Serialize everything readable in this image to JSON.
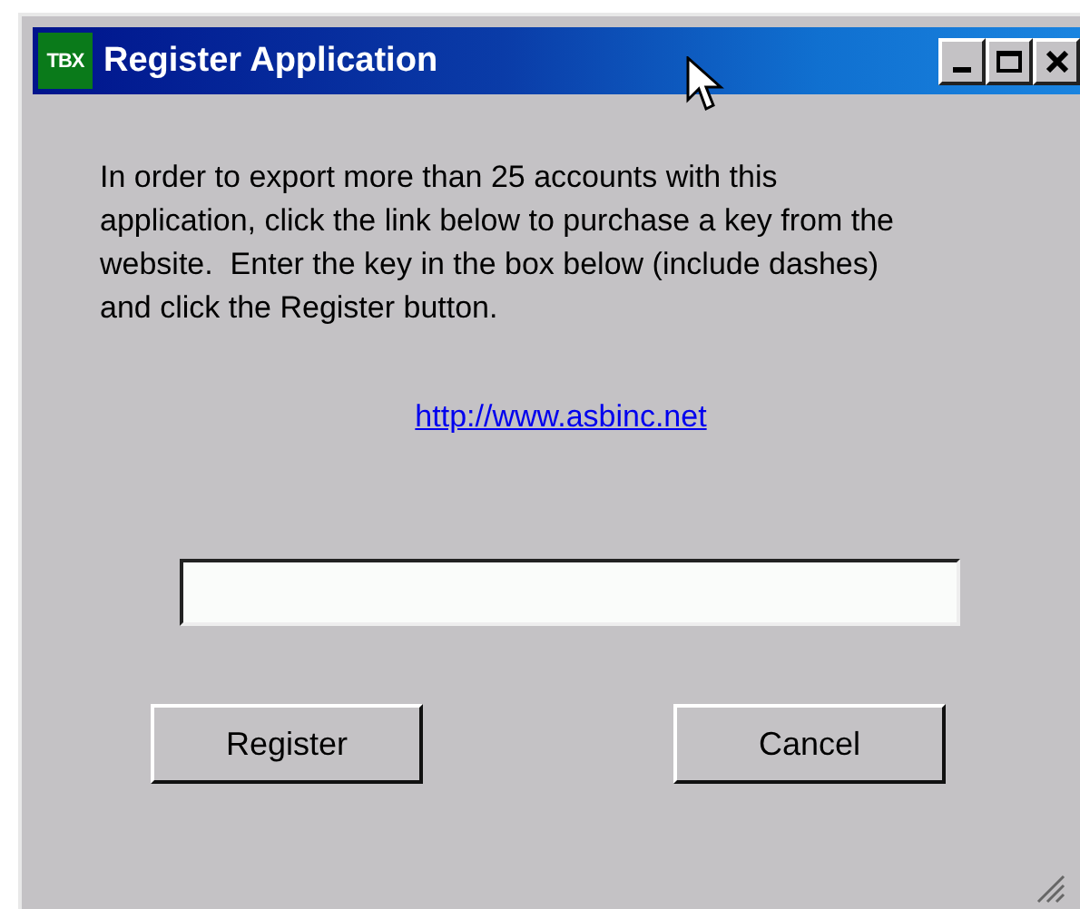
{
  "window": {
    "icon_text": "TBX",
    "title": "Register Application"
  },
  "message": "In order to export more than 25 accounts with this application, click the link below to purchase a key from the website.  Enter the key in the box below (include dashes) and click the Register button.",
  "link": "http://www.asbinc.net",
  "buttons": [
    "Register",
    "Cancel"
  ]
}
